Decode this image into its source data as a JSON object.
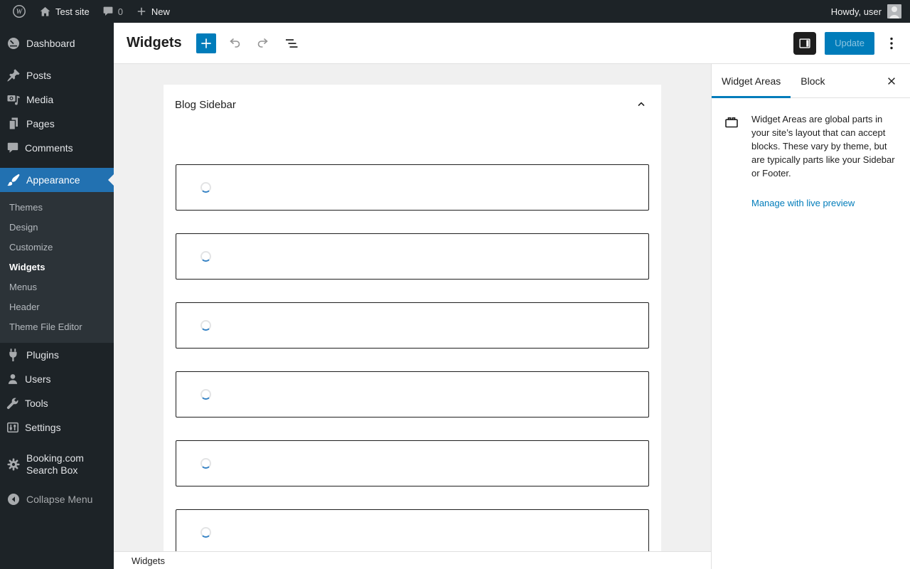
{
  "admin_bar": {
    "site_name": "Test site",
    "comments_count": "0",
    "new_label": "New",
    "greeting": "Howdy, user"
  },
  "sidebar": {
    "items": [
      {
        "label": "Dashboard"
      },
      {
        "label": "Posts"
      },
      {
        "label": "Media"
      },
      {
        "label": "Pages"
      },
      {
        "label": "Comments"
      },
      {
        "label": "Appearance"
      },
      {
        "label": "Plugins"
      },
      {
        "label": "Users"
      },
      {
        "label": "Tools"
      },
      {
        "label": "Settings"
      },
      {
        "label": "Booking.com Search Box"
      },
      {
        "label": "Collapse Menu"
      }
    ],
    "appearance_submenu": [
      "Themes",
      "Design",
      "Customize",
      "Widgets",
      "Menus",
      "Header",
      "Theme File Editor"
    ]
  },
  "editor_header": {
    "title": "Widgets",
    "update_label": "Update"
  },
  "widget_area": {
    "title": "Blog Sidebar",
    "loading_count": 6
  },
  "inspector": {
    "tab_widget_areas": "Widget Areas",
    "tab_block": "Block",
    "description": "Widget Areas are global parts in your site’s layout that can accept blocks. These vary by theme, but are typically parts like your Sidebar or Footer.",
    "link_label": "Manage with live preview"
  },
  "footer": {
    "breadcrumb": "Widgets"
  },
  "colors": {
    "accent": "#2271b1",
    "editor_accent": "#007cba"
  }
}
